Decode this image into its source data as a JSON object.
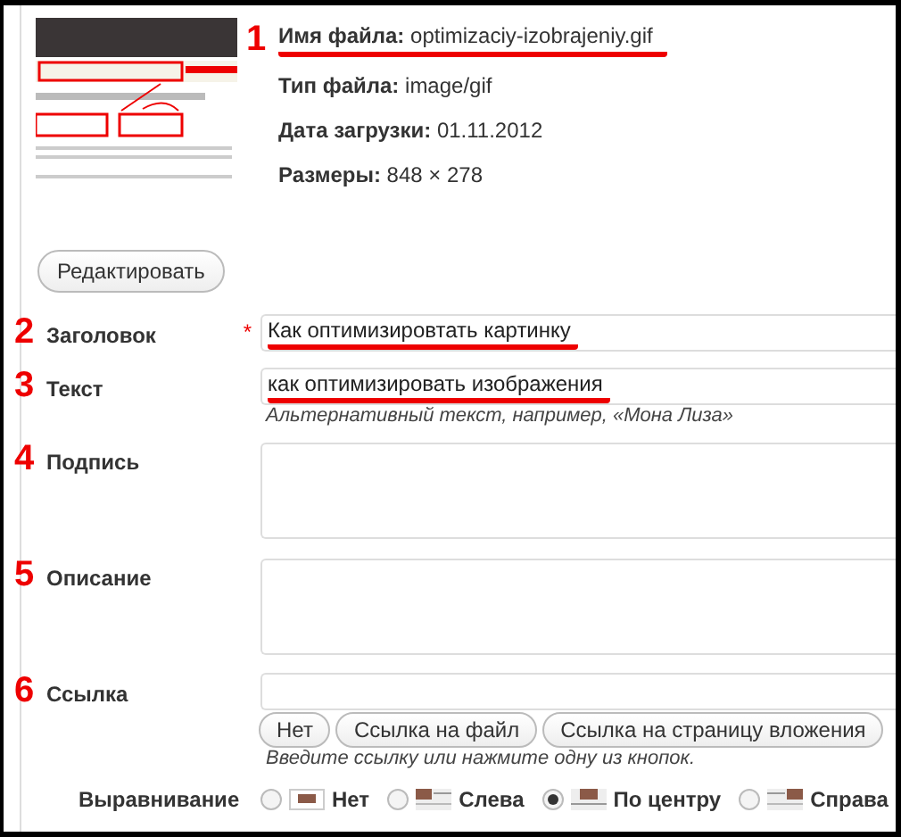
{
  "file_info": [
    {
      "marker": "1",
      "label": "Имя файла:",
      "value": "optimizaciy-izobrajeniy.gif",
      "underlined": true
    },
    {
      "label": "Тип файла:",
      "value": "image/gif",
      "underlined": false
    },
    {
      "label": "Дата загрузки:",
      "value": "01.11.2012",
      "underlined": false
    },
    {
      "label": "Размеры:",
      "value": "848 × 278",
      "underlined": false
    }
  ],
  "edit_button": "Редактировать",
  "fields": [
    {
      "kind": "input",
      "marker": "2",
      "label": "Заголовок",
      "required_mark": "*",
      "value": "Как оптимизировтать картинку",
      "underlined": true
    },
    {
      "kind": "input",
      "marker": "3",
      "label": "Текст",
      "value": "как оптимизировать изображения",
      "underlined": true,
      "hint": "Альтернативный текст, например, «Мона Лиза»"
    },
    {
      "kind": "textarea",
      "marker": "4",
      "label": "Подпись"
    },
    {
      "kind": "textarea",
      "marker": "5",
      "label": "Описание"
    },
    {
      "kind": "link",
      "marker": "6",
      "label": "Ссылка",
      "buttons": [
        "Нет",
        "Ссылка на файл",
        "Ссылка на страницу вложения"
      ],
      "hint": "Введите ссылку или нажмите одну из кнопок."
    }
  ],
  "alignment": {
    "label": "Выравнивание",
    "options": [
      {
        "kind": "none",
        "label": "Нет",
        "selected": false
      },
      {
        "kind": "left",
        "label": "Слева",
        "selected": false
      },
      {
        "kind": "center",
        "label": "По центру",
        "selected": true
      },
      {
        "kind": "right",
        "label": "Справа",
        "selected": false
      }
    ]
  }
}
